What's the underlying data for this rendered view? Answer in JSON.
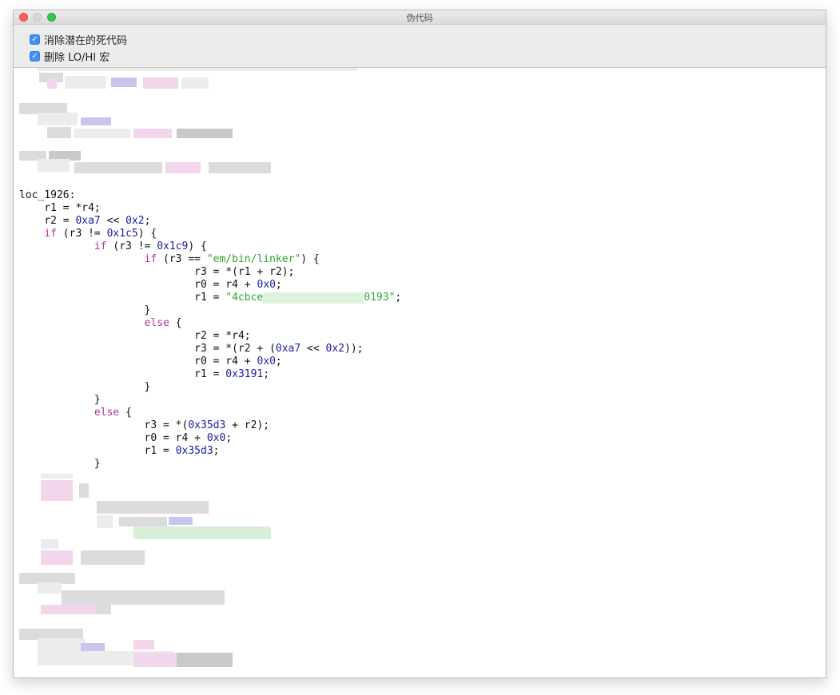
{
  "window": {
    "title": "伪代码"
  },
  "options": [
    {
      "label": "消除潜在的死代码",
      "checked": true
    },
    {
      "label": "删除 LO/HI 宏",
      "checked": true
    }
  ],
  "code": {
    "label": "loc_1926:",
    "l1_a": "r1 = *r4;",
    "l2_a": "r2 = ",
    "l2_n1": "0xa7",
    "l2_b": " << ",
    "l2_n2": "0x2",
    "l2_c": ";",
    "l3_kw": "if",
    "l3_a": " (r3 != ",
    "l3_n": "0x1c5",
    "l3_b": ") {",
    "l4_kw": "if",
    "l4_a": " (r3 != ",
    "l4_n": "0x1c9",
    "l4_b": ") {",
    "l5_kw": "if",
    "l5_a": " (r3 == ",
    "l5_s": "\"em/bin/linker\"",
    "l5_b": ") {",
    "l6_a": "r3 = *(r1 + r2);",
    "l7_a": "r0 = r4 + ",
    "l7_n": "0x0",
    "l7_b": ";",
    "l8_a": "r1 = ",
    "l8_s1": "\"4cbce",
    "l8_s2": "0193\"",
    "l8_b": ";",
    "close": "}",
    "else": "else",
    "open": " {",
    "l11_a": "r2 = *r4;",
    "l12_a": "r3 = *(r2 + (",
    "l12_n1": "0xa7",
    "l12_b": " << ",
    "l12_n2": "0x2",
    "l12_c": "));",
    "l13_a": "r0 = r4 + ",
    "l13_n": "0x0",
    "l13_b": ";",
    "l14_a": "r1 = ",
    "l14_n": "0x3191",
    "l14_b": ";",
    "l17_a": "r3 = *(",
    "l17_n": "0x35d3",
    "l17_b": " + r2);",
    "l18_a": "r0 = r4 + ",
    "l18_n": "0x0",
    "l18_b": ";",
    "l19_a": "r1 = ",
    "l19_n": "0x35d3",
    "l19_b": ";"
  },
  "colors": {
    "keyword": "#b5339a",
    "number": "#1c1ca8",
    "string": "#2fa52f",
    "checkbox": "#3f8ff7"
  }
}
